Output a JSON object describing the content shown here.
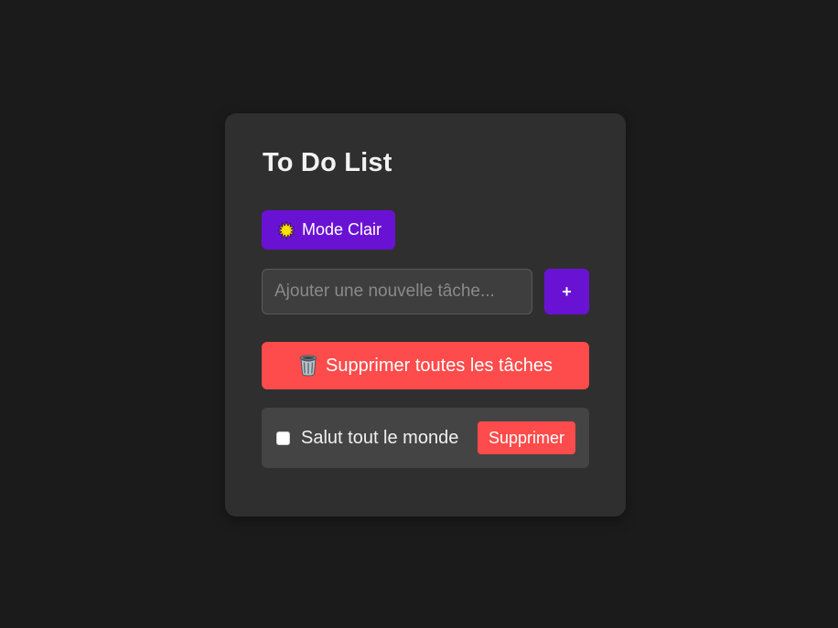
{
  "app": {
    "title": "To Do List"
  },
  "theme_toggle": {
    "icon": "sun-icon",
    "label": "Mode Clair"
  },
  "new_task": {
    "placeholder": "Ajouter une nouvelle tâche...",
    "value": "",
    "add_label": "+"
  },
  "clear_all": {
    "icon": "trash-icon",
    "label": "Supprimer toutes les tâches"
  },
  "tasks": [
    {
      "text": "Salut tout le monde",
      "done": false,
      "delete_label": "Supprimer"
    }
  ],
  "colors": {
    "background": "#1b1b1b",
    "card": "#2f2f2f",
    "accent": "#6a12d4",
    "danger": "#fe4b4b",
    "task_bg": "#444444"
  }
}
